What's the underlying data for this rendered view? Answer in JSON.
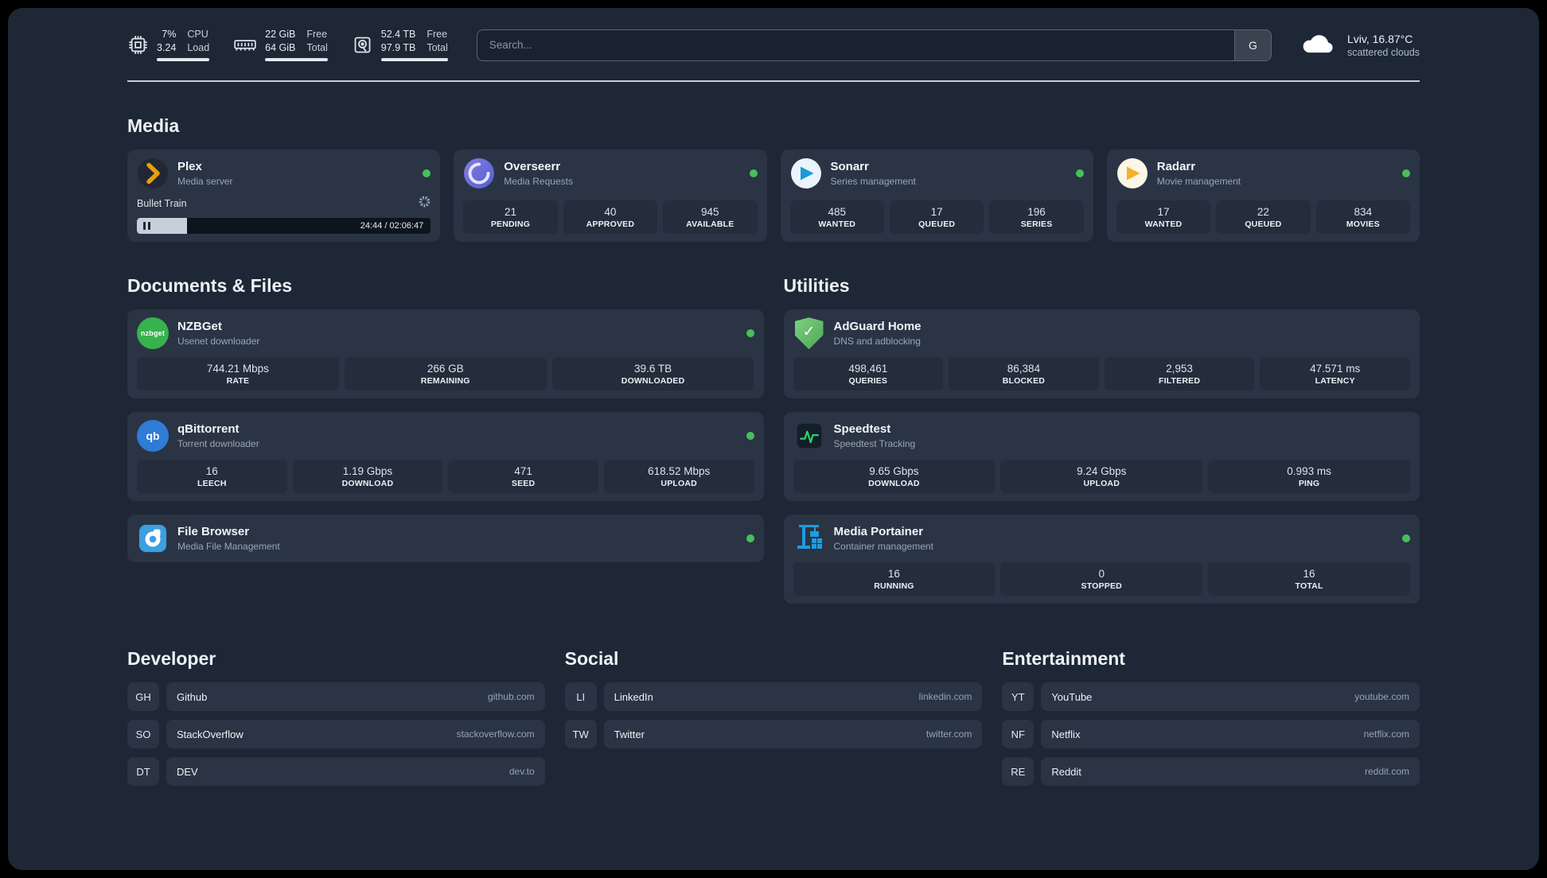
{
  "icons": {
    "adguard_check": "✓"
  },
  "header": {
    "cpu": {
      "line1": "7%",
      "line2": "3.24",
      "label1": "CPU",
      "label2": "Load"
    },
    "memory": {
      "line1": "22 GiB",
      "line2": "64 GiB",
      "label1": "Free",
      "label2": "Total"
    },
    "disk": {
      "line1": "52.4 TB",
      "line2": "97.9 TB",
      "label1": "Free",
      "label2": "Total"
    },
    "search": {
      "placeholder": "Search...",
      "button_label": "G"
    },
    "weather": {
      "location": "Lviv, 16.87°C",
      "condition": "scattered clouds"
    }
  },
  "sections": {
    "media": {
      "title": "Media",
      "cards": [
        {
          "name": "Plex",
          "subtitle": "Media server",
          "status": "online",
          "widget": {
            "track_title": "Bullet Train",
            "time": "24:44 / 02:06:47",
            "progress_percent": 17,
            "state": "paused"
          }
        },
        {
          "name": "Overseerr",
          "subtitle": "Media Requests",
          "status": "online",
          "stats": [
            {
              "value": "21",
              "label": "PENDING"
            },
            {
              "value": "40",
              "label": "APPROVED"
            },
            {
              "value": "945",
              "label": "AVAILABLE"
            }
          ]
        },
        {
          "name": "Sonarr",
          "subtitle": "Series management",
          "status": "online",
          "stats": [
            {
              "value": "485",
              "label": "WANTED"
            },
            {
              "value": "17",
              "label": "QUEUED"
            },
            {
              "value": "196",
              "label": "SERIES"
            }
          ]
        },
        {
          "name": "Radarr",
          "subtitle": "Movie management",
          "status": "online",
          "stats": [
            {
              "value": "17",
              "label": "WANTED"
            },
            {
              "value": "22",
              "label": "QUEUED"
            },
            {
              "value": "834",
              "label": "MOVIES"
            }
          ]
        }
      ]
    },
    "documents": {
      "title": "Documents & Files",
      "cards": [
        {
          "name": "NZBGet",
          "subtitle": "Usenet downloader",
          "status": "online",
          "icon_text": "nzbget",
          "stats": [
            {
              "value": "744.21 Mbps",
              "label": "RATE"
            },
            {
              "value": "266 GB",
              "label": "REMAINING"
            },
            {
              "value": "39.6 TB",
              "label": "DOWNLOADED"
            }
          ]
        },
        {
          "name": "qBittorrent",
          "subtitle": "Torrent downloader",
          "status": "online",
          "icon_text": "qb",
          "stats": [
            {
              "value": "16",
              "label": "LEECH"
            },
            {
              "value": "1.19 Gbps",
              "label": "DOWNLOAD"
            },
            {
              "value": "471",
              "label": "SEED"
            },
            {
              "value": "618.52 Mbps",
              "label": "UPLOAD"
            }
          ]
        },
        {
          "name": "File Browser",
          "subtitle": "Media File Management",
          "status": "online",
          "stats": []
        }
      ]
    },
    "utilities": {
      "title": "Utilities",
      "cards": [
        {
          "name": "AdGuard Home",
          "subtitle": "DNS and adblocking",
          "stats": [
            {
              "value": "498,461",
              "label": "QUERIES"
            },
            {
              "value": "86,384",
              "label": "BLOCKED"
            },
            {
              "value": "2,953",
              "label": "FILTERED"
            },
            {
              "value": "47.571 ms",
              "label": "LATENCY"
            }
          ]
        },
        {
          "name": "Speedtest",
          "subtitle": "Speedtest Tracking",
          "stats": [
            {
              "value": "9.65 Gbps",
              "label": "DOWNLOAD"
            },
            {
              "value": "9.24 Gbps",
              "label": "UPLOAD"
            },
            {
              "value": "0.993 ms",
              "label": "PING"
            }
          ]
        },
        {
          "name": "Media Portainer",
          "subtitle": "Container management",
          "status": "online",
          "stats": [
            {
              "value": "16",
              "label": "RUNNING"
            },
            {
              "value": "0",
              "label": "STOPPED"
            },
            {
              "value": "16",
              "label": "TOTAL"
            }
          ]
        }
      ]
    },
    "bookmarks": [
      {
        "title": "Developer",
        "links": [
          {
            "abbr": "GH",
            "name": "Github",
            "url": "github.com"
          },
          {
            "abbr": "SO",
            "name": "StackOverflow",
            "url": "stackoverflow.com"
          },
          {
            "abbr": "DT",
            "name": "DEV",
            "url": "dev.to"
          }
        ]
      },
      {
        "title": "Social",
        "links": [
          {
            "abbr": "LI",
            "name": "LinkedIn",
            "url": "linkedin.com"
          },
          {
            "abbr": "TW",
            "name": "Twitter",
            "url": "twitter.com"
          }
        ]
      },
      {
        "title": "Entertainment",
        "links": [
          {
            "abbr": "YT",
            "name": "YouTube",
            "url": "youtube.com"
          },
          {
            "abbr": "NF",
            "name": "Netflix",
            "url": "netflix.com"
          },
          {
            "abbr": "RE",
            "name": "Reddit",
            "url": "reddit.com"
          }
        ]
      }
    ]
  },
  "colors": {
    "status-online": "#46c05b",
    "plex": "#e5a00d",
    "overseerr-1": "#8a7ce0",
    "overseerr-2": "#4f5fd0",
    "sonarr": "#1b9ad8",
    "radarr": "#f0b12d",
    "nzbget": "#37b24d",
    "qbittorrent": "#2e7cd6",
    "filebrowser": "#3c9fe0",
    "adguard-1": "#7ed184",
    "adguard-2": "#4da653",
    "speedtest-line": "#2fd06a",
    "portainer": "#1e9ce0"
  }
}
